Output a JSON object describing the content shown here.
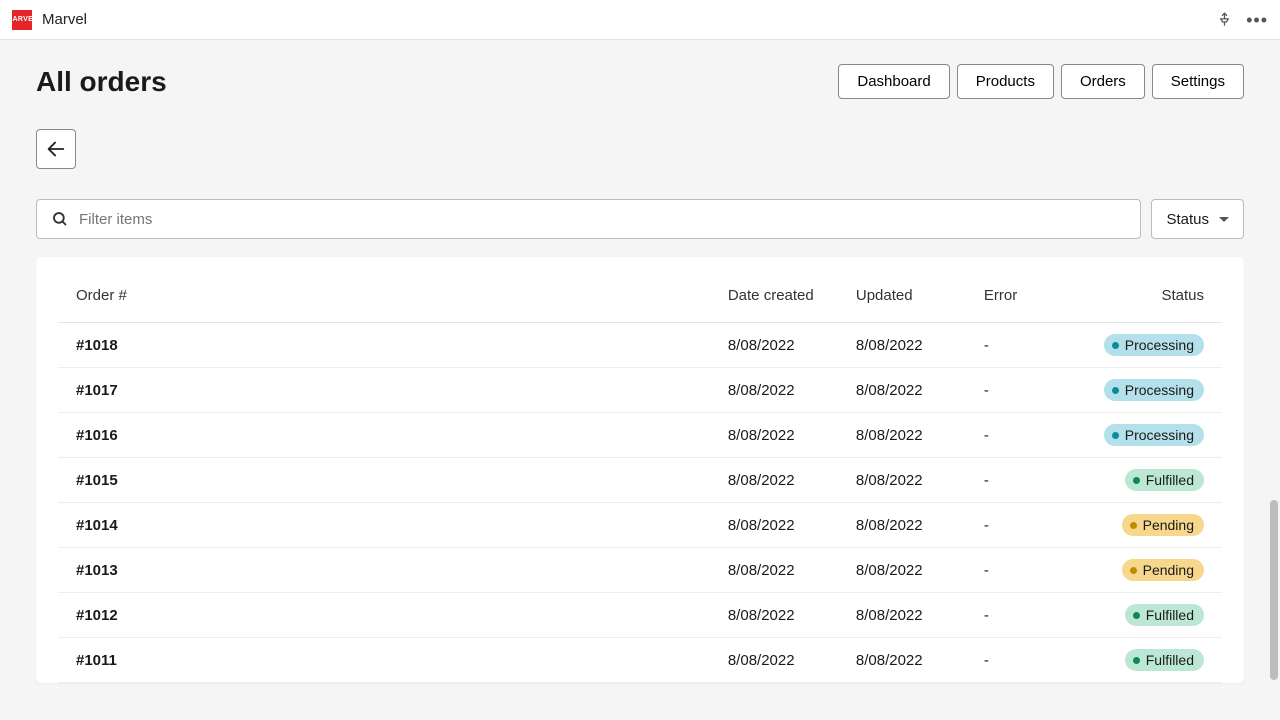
{
  "topbar": {
    "app_name": "Marvel",
    "logo_text": "MARVEL"
  },
  "header": {
    "title": "All orders",
    "nav": {
      "dashboard": "Dashboard",
      "products": "Products",
      "orders": "Orders",
      "settings": "Settings"
    }
  },
  "filter": {
    "search_placeholder": "Filter items",
    "status_label": "Status"
  },
  "table": {
    "columns": {
      "order": "Order #",
      "created": "Date created",
      "updated": "Updated",
      "error": "Error",
      "status": "Status"
    },
    "rows": [
      {
        "order": "#1018",
        "created": "8/08/2022",
        "updated": "8/08/2022",
        "error": "-",
        "status": "Processing",
        "status_class": "processing"
      },
      {
        "order": "#1017",
        "created": "8/08/2022",
        "updated": "8/08/2022",
        "error": "-",
        "status": "Processing",
        "status_class": "processing"
      },
      {
        "order": "#1016",
        "created": "8/08/2022",
        "updated": "8/08/2022",
        "error": "-",
        "status": "Processing",
        "status_class": "processing"
      },
      {
        "order": "#1015",
        "created": "8/08/2022",
        "updated": "8/08/2022",
        "error": "-",
        "status": "Fulfilled",
        "status_class": "fulfilled"
      },
      {
        "order": "#1014",
        "created": "8/08/2022",
        "updated": "8/08/2022",
        "error": "-",
        "status": "Pending",
        "status_class": "pending"
      },
      {
        "order": "#1013",
        "created": "8/08/2022",
        "updated": "8/08/2022",
        "error": "-",
        "status": "Pending",
        "status_class": "pending"
      },
      {
        "order": "#1012",
        "created": "8/08/2022",
        "updated": "8/08/2022",
        "error": "-",
        "status": "Fulfilled",
        "status_class": "fulfilled"
      },
      {
        "order": "#1011",
        "created": "8/08/2022",
        "updated": "8/08/2022",
        "error": "-",
        "status": "Fulfilled",
        "status_class": "fulfilled"
      }
    ]
  }
}
